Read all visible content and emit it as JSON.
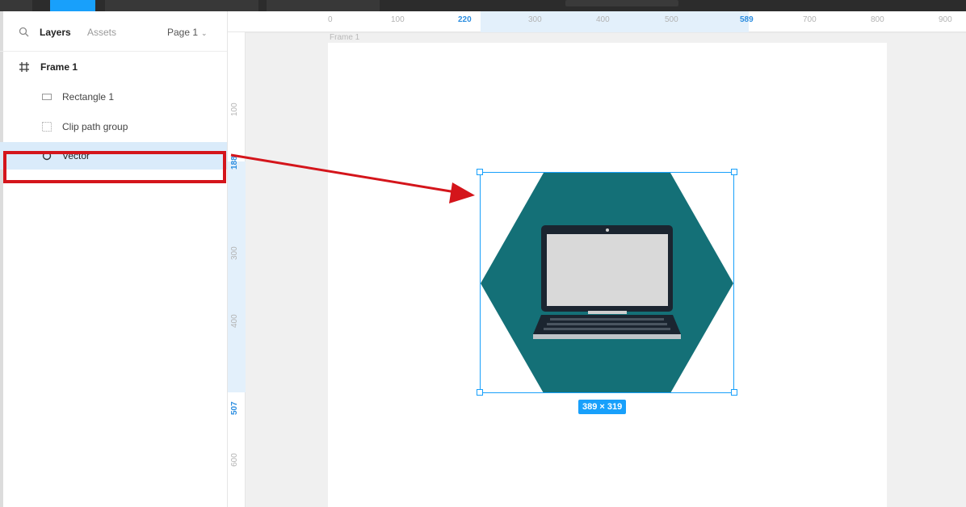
{
  "toolbar": {},
  "panel": {
    "tabs": {
      "layers": "Layers",
      "assets": "Assets"
    },
    "page_select": "Page 1",
    "icons": {
      "search": "search-icon",
      "chevron": "chevron-down-icon"
    }
  },
  "layers": {
    "items": [
      {
        "label": "Frame 1",
        "icon": "frame-grid-icon"
      },
      {
        "label": "Rectangle 1",
        "icon": "rectangle-icon"
      },
      {
        "label": "Clip path group",
        "icon": "clip-group-icon"
      },
      {
        "label": "Vector",
        "icon": "vector-icon",
        "selected": true
      }
    ]
  },
  "rulers": {
    "top": [
      "0",
      "100",
      "220",
      "300",
      "400",
      "500",
      "589",
      "700",
      "800",
      "900"
    ],
    "left": [
      "100",
      "188",
      "300",
      "400",
      "507",
      "600"
    ]
  },
  "canvas": {
    "frame_label": "Frame 1",
    "selection_size": "389 × 319",
    "colors": {
      "hexagon": "#147077",
      "selection": "#18a0fb",
      "highlight": "#d4151b"
    }
  }
}
